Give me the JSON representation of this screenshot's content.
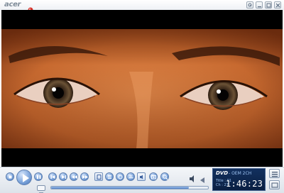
{
  "app": {
    "brand": "acer"
  },
  "titlebar": {
    "icons": [
      "record-icon",
      "settings-icon",
      "minimize-icon",
      "maximize-icon",
      "close-icon"
    ]
  },
  "video": {
    "content": "close-up-eyes-frame"
  },
  "controls": {
    "buttons": [
      "stop-icon",
      "play-icon",
      "pause-icon",
      "previous-chapter-icon",
      "rewind-icon",
      "forward-icon",
      "next-chapter-icon",
      "step-icon",
      "menu-icon",
      "angle-icon",
      "subtitle-icon",
      "audio-icon",
      "snapshot-icon",
      "zoom-icon",
      "repeat-icon",
      "speaker-icon"
    ],
    "progress": 0.88
  },
  "display": {
    "format": "DVD",
    "audio": "- OEM 2CH",
    "title_label": "Title : 01",
    "chapter_label": "Ch : 27",
    "time": "1:46:23"
  },
  "colors": {
    "accent": "#4f7fc6",
    "display_bg": "#0a1f42"
  }
}
